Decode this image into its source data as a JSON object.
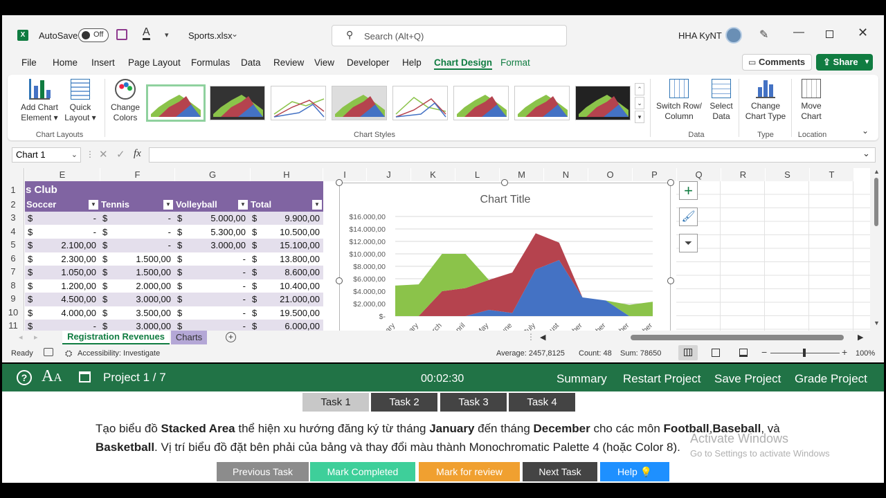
{
  "titlebar": {
    "autosave_label": "AutoSave",
    "autosave_state": "Off",
    "filename": "Sports.xlsx",
    "search_placeholder": "Search (Alt+Q)",
    "user_name": "HHA KyNT"
  },
  "menu": {
    "items": [
      "File",
      "Home",
      "Insert",
      "Page Layout",
      "Formulas",
      "Data",
      "Review",
      "View",
      "Developer",
      "Help",
      "Chart Design",
      "Format"
    ],
    "comments": "Comments",
    "share": "Share"
  },
  "ribbon": {
    "add_chart_element": [
      "Add Chart",
      "Element"
    ],
    "quick_layout": [
      "Quick",
      "Layout"
    ],
    "change_colors": [
      "Change",
      "Colors"
    ],
    "switch_row_col": [
      "Switch Row/",
      "Column"
    ],
    "select_data": [
      "Select",
      "Data"
    ],
    "change_chart_type": [
      "Change",
      "Chart Type"
    ],
    "move_chart": [
      "Move",
      "Chart"
    ],
    "groups": {
      "layouts": "Chart Layouts",
      "styles": "Chart Styles",
      "data": "Data",
      "type": "Type",
      "location": "Location"
    }
  },
  "formula": {
    "namebox": "Chart 1",
    "fx": "fx",
    "value": ""
  },
  "sheet": {
    "columns": [
      "E",
      "F",
      "G",
      "H",
      "I",
      "J",
      "K",
      "L",
      "M",
      "N",
      "O",
      "P",
      "Q",
      "R",
      "S",
      "T"
    ],
    "title_fragment": "s Club",
    "headers": [
      "Soccer",
      "Tennis",
      "Volleyball",
      "Total"
    ],
    "currency": "$",
    "rows": [
      {
        "n": "1"
      },
      {
        "n": "2"
      },
      {
        "n": "3",
        "v": [
          "-",
          "-",
          "5.000,00",
          "9.900,00"
        ]
      },
      {
        "n": "4",
        "v": [
          "-",
          "-",
          "5.300,00",
          "10.500,00"
        ]
      },
      {
        "n": "5",
        "v": [
          "2.100,00",
          "-",
          "3.000,00",
          "15.100,00"
        ]
      },
      {
        "n": "6",
        "v": [
          "2.300,00",
          "1.500,00",
          "-",
          "13.800,00"
        ]
      },
      {
        "n": "7",
        "v": [
          "1.050,00",
          "1.500,00",
          "-",
          "8.600,00"
        ]
      },
      {
        "n": "8",
        "v": [
          "1.200,00",
          "2.000,00",
          "-",
          "10.400,00"
        ]
      },
      {
        "n": "9",
        "v": [
          "4.500,00",
          "3.000,00",
          "-",
          "21.000,00"
        ]
      },
      {
        "n": "10",
        "v": [
          "4.000,00",
          "3.500,00",
          "-",
          "19.500,00"
        ]
      },
      {
        "n": "11",
        "v": [
          "-",
          "3.000,00",
          "-",
          "6.000,00"
        ]
      }
    ]
  },
  "chart_data": {
    "type": "area",
    "stacked": true,
    "title": "Chart Title",
    "yticks": [
      "$-",
      "$2.000,00",
      "$4.000,00",
      "$6.000,00",
      "$8.000,00",
      "$10.000,00",
      "$12.000,00",
      "$14.000,00",
      "$16.000,00"
    ],
    "ylim": [
      0,
      16000
    ],
    "categories": [
      "January",
      "February",
      "March",
      "April",
      "May",
      "June",
      "July",
      "August",
      "September",
      "October",
      "November",
      "December"
    ],
    "category_labels": [
      "ary",
      "uary",
      "rch",
      "pril",
      "May",
      "une",
      "July",
      "ust",
      "mber",
      "ober",
      "mber",
      "mber"
    ],
    "series": [
      {
        "color": "#4472c4",
        "values": [
          0,
          0,
          0,
          0,
          1000,
          500,
          7500,
          9000,
          3000,
          2500,
          0,
          0
        ]
      },
      {
        "color": "#b5434e",
        "values": [
          0,
          0,
          4000,
          4500,
          4800,
          6500,
          5800,
          2800,
          0,
          0,
          0,
          0
        ]
      },
      {
        "color": "#8bc34a",
        "values": [
          4900,
          5100,
          6000,
          5500,
          0,
          0,
          0,
          0,
          0,
          0,
          1800,
          2300
        ]
      }
    ],
    "grid": true,
    "legend": "none"
  },
  "tabs": {
    "sheets": [
      "Registration Revenues",
      "Charts"
    ]
  },
  "status": {
    "ready": "Ready",
    "accessibility": "Accessibility: Investigate",
    "average": "Average: 2457,8125",
    "count": "Count: 48",
    "sum": "Sum: 78650",
    "zoom": "100%"
  },
  "project": {
    "label": "Project 1 / 7",
    "timer": "00:02:30",
    "actions": [
      "Summary",
      "Restart Project",
      "Save Project",
      "Grade Project"
    ]
  },
  "tasks": [
    "Task 1",
    "Task 2",
    "Task 3",
    "Task 4"
  ],
  "instruction": {
    "p1": "Tạo biểu đồ ",
    "b1": "Stacked Area",
    "p2": " thể hiện xu hướng đăng ký từ tháng ",
    "b2": "January",
    "p3": " đến tháng ",
    "b3": "December",
    "p4": " cho các môn ",
    "b4": "Football",
    "p5": ",",
    "b5": "Baseball",
    "p6": ", và ",
    "b6": "Basketball",
    "p7": ". Vị trí biểu đồ đặt bên phải của bảng và thay đổi màu thành Monochromatic Palette 4 (hoặc Color 8)."
  },
  "watermark": {
    "line1": "Activate Windows",
    "line2": "Go to Settings to activate Windows"
  },
  "buttons": {
    "prev": "Previous Task",
    "mark": "Mark Completed",
    "review": "Mark for review",
    "next": "Next Task",
    "help": "Help"
  }
}
